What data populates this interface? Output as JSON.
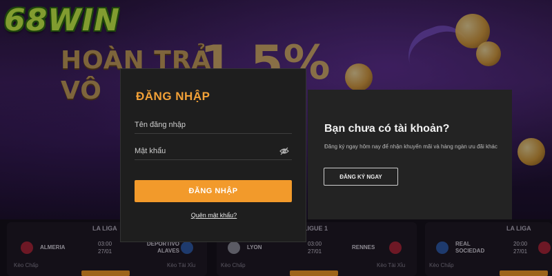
{
  "brand": {
    "logo_text": "68WIN"
  },
  "banner": {
    "promo_line1": "HOÀN TRẢ",
    "promo_line2": "VÔ",
    "promo_big": "1.5%"
  },
  "login": {
    "title": "ĐĂNG NHẬP",
    "username_placeholder": "Tên đăng nhập",
    "password_placeholder": "Mật khẩu",
    "submit_label": "ĐĂNG NHẬP",
    "forgot_label": "Quên mật khẩu?"
  },
  "signup": {
    "title": "Bạn chưa có tài khoản?",
    "description": "Đăng ký ngay hôm nay để nhận khuyến mãi và hàng ngàn ưu đãi khác",
    "button_label": "ĐĂNG KÝ NGAY"
  },
  "matches": {
    "m1": {
      "league": "LA LIGA",
      "home": "ALMERIA",
      "away": "DEPORTIVO ALAVES",
      "time": "03:00",
      "date": "27/01",
      "kind_left": "Kèo Chấp",
      "kind_right": "Kèo Tài Xỉu"
    },
    "m2": {
      "league": "LIGUE 1",
      "home": "LYON",
      "away": "RENNES",
      "time": "03:00",
      "date": "27/01",
      "kind_left": "Kèo Chấp",
      "kind_right": "Kèo Tài Xỉu"
    },
    "m3": {
      "league": "LA LIGA",
      "home": "REAL SOCIEDAD",
      "time": "20:00",
      "date": "27/01",
      "kind_left": "Kèo Chấp"
    }
  },
  "colors": {
    "accent": "#f29a2b",
    "title_orange": "#f3a137",
    "logo_green": "#c6f04a"
  },
  "icons": {
    "password_toggle": "eye-off-icon"
  }
}
